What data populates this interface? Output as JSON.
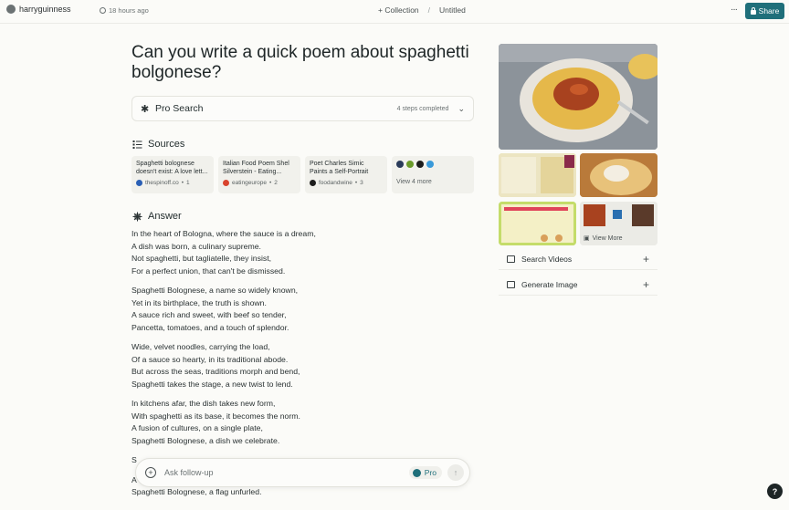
{
  "topbar": {
    "username": "harryguinness",
    "timestamp": "18 hours ago",
    "collection_label": "+ Collection",
    "separator": "/",
    "thread_title": "Untitled",
    "more_label": "···",
    "share_label": "Share"
  },
  "question": "Can you write a quick poem about spaghetti bolgonese?",
  "pro_search": {
    "label": "Pro Search",
    "steps": "4 steps completed"
  },
  "sources": {
    "heading": "Sources",
    "items": [
      {
        "title": "Spaghetti bolognese doesn't exist: A love lett...",
        "site": "thespinoff.co",
        "index": "1",
        "color": "#2a5fb5"
      },
      {
        "title": "Italian Food Poem Shel Silverstein - Eating...",
        "site": "eatingeurope",
        "index": "2",
        "color": "#d9442e"
      },
      {
        "title": "Poet Charles Simic Paints a Self-Portrait with...",
        "site": "foodandwine",
        "index": "3",
        "color": "#1d1d1d"
      }
    ],
    "view_more": "View 4 more"
  },
  "answer": {
    "heading": "Answer",
    "stanzas": [
      [
        "In the heart of Bologna, where the sauce is a dream,",
        "A dish was born, a culinary supreme.",
        "Not spaghetti, but tagliatelle, they insist,",
        "For a perfect union, that can't be dismissed."
      ],
      [
        "Spaghetti Bolognese, a name so widely known,",
        "Yet in its birthplace, the truth is shown.",
        "A sauce rich and sweet, with beef so tender,",
        "Pancetta, tomatoes, and a touch of splendor."
      ],
      [
        "Wide, velvet noodles, carrying the load,",
        "Of a sauce so hearty, in its traditional abode.",
        "But across the seas, traditions morph and bend,",
        "Spaghetti takes the stage, a new twist to lend."
      ],
      [
        "In kitchens afar, the dish takes new form,",
        "With spaghetti as its base, it becomes the norm.",
        "A fusion of cultures, on a single plate,",
        "Spaghetti Bolognese, a dish we celebrate."
      ],
      [
        "S",
        "A",
        "Spaghetti Bolognese, a flag unfurled."
      ]
    ]
  },
  "followup": {
    "placeholder": "Ask follow-up",
    "pro_label": "Pro"
  },
  "side": {
    "view_more_images": "View More",
    "search_videos": "Search Videos",
    "generate_image": "Generate Image"
  },
  "help_label": "?"
}
